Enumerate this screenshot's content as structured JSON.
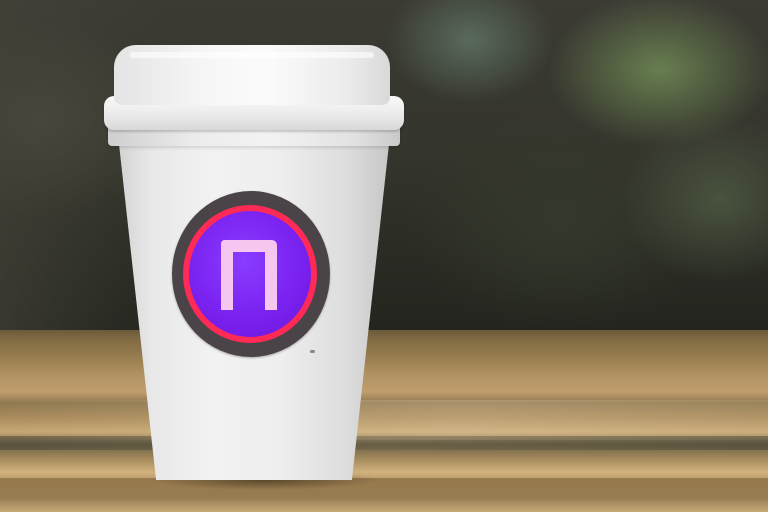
{
  "scene": {
    "description_type": "photo",
    "subject": "paper-coffee-cup",
    "logo": {
      "icon": "stylized-n-logo-icon",
      "colors": {
        "outer": "#4a4448",
        "ring": "#ff2a55",
        "fill": "#7a22f0",
        "glyph": "#f5c6ef"
      }
    },
    "colors": {
      "cup": "#eeeeee",
      "table": "#b39465",
      "background": "#2a2a20"
    }
  }
}
